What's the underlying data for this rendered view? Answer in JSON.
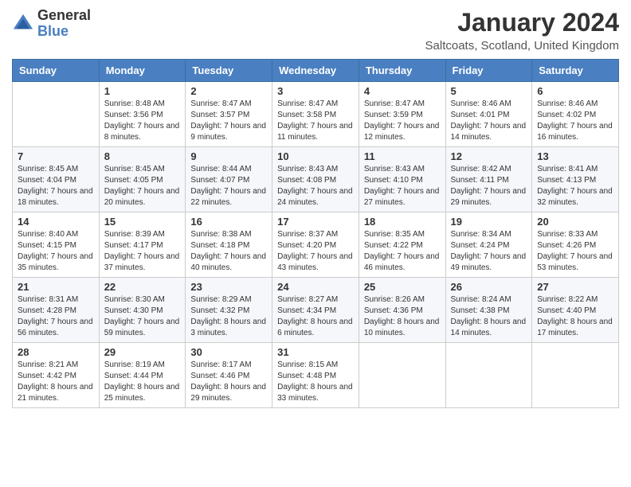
{
  "header": {
    "logo_general": "General",
    "logo_blue": "Blue",
    "month_title": "January 2024",
    "location": "Saltcoats, Scotland, United Kingdom"
  },
  "weekdays": [
    "Sunday",
    "Monday",
    "Tuesday",
    "Wednesday",
    "Thursday",
    "Friday",
    "Saturday"
  ],
  "weeks": [
    [
      {
        "date": "",
        "sunrise": "",
        "sunset": "",
        "daylight": ""
      },
      {
        "date": "1",
        "sunrise": "Sunrise: 8:48 AM",
        "sunset": "Sunset: 3:56 PM",
        "daylight": "Daylight: 7 hours and 8 minutes."
      },
      {
        "date": "2",
        "sunrise": "Sunrise: 8:47 AM",
        "sunset": "Sunset: 3:57 PM",
        "daylight": "Daylight: 7 hours and 9 minutes."
      },
      {
        "date": "3",
        "sunrise": "Sunrise: 8:47 AM",
        "sunset": "Sunset: 3:58 PM",
        "daylight": "Daylight: 7 hours and 11 minutes."
      },
      {
        "date": "4",
        "sunrise": "Sunrise: 8:47 AM",
        "sunset": "Sunset: 3:59 PM",
        "daylight": "Daylight: 7 hours and 12 minutes."
      },
      {
        "date": "5",
        "sunrise": "Sunrise: 8:46 AM",
        "sunset": "Sunset: 4:01 PM",
        "daylight": "Daylight: 7 hours and 14 minutes."
      },
      {
        "date": "6",
        "sunrise": "Sunrise: 8:46 AM",
        "sunset": "Sunset: 4:02 PM",
        "daylight": "Daylight: 7 hours and 16 minutes."
      }
    ],
    [
      {
        "date": "7",
        "sunrise": "Sunrise: 8:45 AM",
        "sunset": "Sunset: 4:04 PM",
        "daylight": "Daylight: 7 hours and 18 minutes."
      },
      {
        "date": "8",
        "sunrise": "Sunrise: 8:45 AM",
        "sunset": "Sunset: 4:05 PM",
        "daylight": "Daylight: 7 hours and 20 minutes."
      },
      {
        "date": "9",
        "sunrise": "Sunrise: 8:44 AM",
        "sunset": "Sunset: 4:07 PM",
        "daylight": "Daylight: 7 hours and 22 minutes."
      },
      {
        "date": "10",
        "sunrise": "Sunrise: 8:43 AM",
        "sunset": "Sunset: 4:08 PM",
        "daylight": "Daylight: 7 hours and 24 minutes."
      },
      {
        "date": "11",
        "sunrise": "Sunrise: 8:43 AM",
        "sunset": "Sunset: 4:10 PM",
        "daylight": "Daylight: 7 hours and 27 minutes."
      },
      {
        "date": "12",
        "sunrise": "Sunrise: 8:42 AM",
        "sunset": "Sunset: 4:11 PM",
        "daylight": "Daylight: 7 hours and 29 minutes."
      },
      {
        "date": "13",
        "sunrise": "Sunrise: 8:41 AM",
        "sunset": "Sunset: 4:13 PM",
        "daylight": "Daylight: 7 hours and 32 minutes."
      }
    ],
    [
      {
        "date": "14",
        "sunrise": "Sunrise: 8:40 AM",
        "sunset": "Sunset: 4:15 PM",
        "daylight": "Daylight: 7 hours and 35 minutes."
      },
      {
        "date": "15",
        "sunrise": "Sunrise: 8:39 AM",
        "sunset": "Sunset: 4:17 PM",
        "daylight": "Daylight: 7 hours and 37 minutes."
      },
      {
        "date": "16",
        "sunrise": "Sunrise: 8:38 AM",
        "sunset": "Sunset: 4:18 PM",
        "daylight": "Daylight: 7 hours and 40 minutes."
      },
      {
        "date": "17",
        "sunrise": "Sunrise: 8:37 AM",
        "sunset": "Sunset: 4:20 PM",
        "daylight": "Daylight: 7 hours and 43 minutes."
      },
      {
        "date": "18",
        "sunrise": "Sunrise: 8:35 AM",
        "sunset": "Sunset: 4:22 PM",
        "daylight": "Daylight: 7 hours and 46 minutes."
      },
      {
        "date": "19",
        "sunrise": "Sunrise: 8:34 AM",
        "sunset": "Sunset: 4:24 PM",
        "daylight": "Daylight: 7 hours and 49 minutes."
      },
      {
        "date": "20",
        "sunrise": "Sunrise: 8:33 AM",
        "sunset": "Sunset: 4:26 PM",
        "daylight": "Daylight: 7 hours and 53 minutes."
      }
    ],
    [
      {
        "date": "21",
        "sunrise": "Sunrise: 8:31 AM",
        "sunset": "Sunset: 4:28 PM",
        "daylight": "Daylight: 7 hours and 56 minutes."
      },
      {
        "date": "22",
        "sunrise": "Sunrise: 8:30 AM",
        "sunset": "Sunset: 4:30 PM",
        "daylight": "Daylight: 7 hours and 59 minutes."
      },
      {
        "date": "23",
        "sunrise": "Sunrise: 8:29 AM",
        "sunset": "Sunset: 4:32 PM",
        "daylight": "Daylight: 8 hours and 3 minutes."
      },
      {
        "date": "24",
        "sunrise": "Sunrise: 8:27 AM",
        "sunset": "Sunset: 4:34 PM",
        "daylight": "Daylight: 8 hours and 6 minutes."
      },
      {
        "date": "25",
        "sunrise": "Sunrise: 8:26 AM",
        "sunset": "Sunset: 4:36 PM",
        "daylight": "Daylight: 8 hours and 10 minutes."
      },
      {
        "date": "26",
        "sunrise": "Sunrise: 8:24 AM",
        "sunset": "Sunset: 4:38 PM",
        "daylight": "Daylight: 8 hours and 14 minutes."
      },
      {
        "date": "27",
        "sunrise": "Sunrise: 8:22 AM",
        "sunset": "Sunset: 4:40 PM",
        "daylight": "Daylight: 8 hours and 17 minutes."
      }
    ],
    [
      {
        "date": "28",
        "sunrise": "Sunrise: 8:21 AM",
        "sunset": "Sunset: 4:42 PM",
        "daylight": "Daylight: 8 hours and 21 minutes."
      },
      {
        "date": "29",
        "sunrise": "Sunrise: 8:19 AM",
        "sunset": "Sunset: 4:44 PM",
        "daylight": "Daylight: 8 hours and 25 minutes."
      },
      {
        "date": "30",
        "sunrise": "Sunrise: 8:17 AM",
        "sunset": "Sunset: 4:46 PM",
        "daylight": "Daylight: 8 hours and 29 minutes."
      },
      {
        "date": "31",
        "sunrise": "Sunrise: 8:15 AM",
        "sunset": "Sunset: 4:48 PM",
        "daylight": "Daylight: 8 hours and 33 minutes."
      },
      {
        "date": "",
        "sunrise": "",
        "sunset": "",
        "daylight": ""
      },
      {
        "date": "",
        "sunrise": "",
        "sunset": "",
        "daylight": ""
      },
      {
        "date": "",
        "sunrise": "",
        "sunset": "",
        "daylight": ""
      }
    ]
  ]
}
